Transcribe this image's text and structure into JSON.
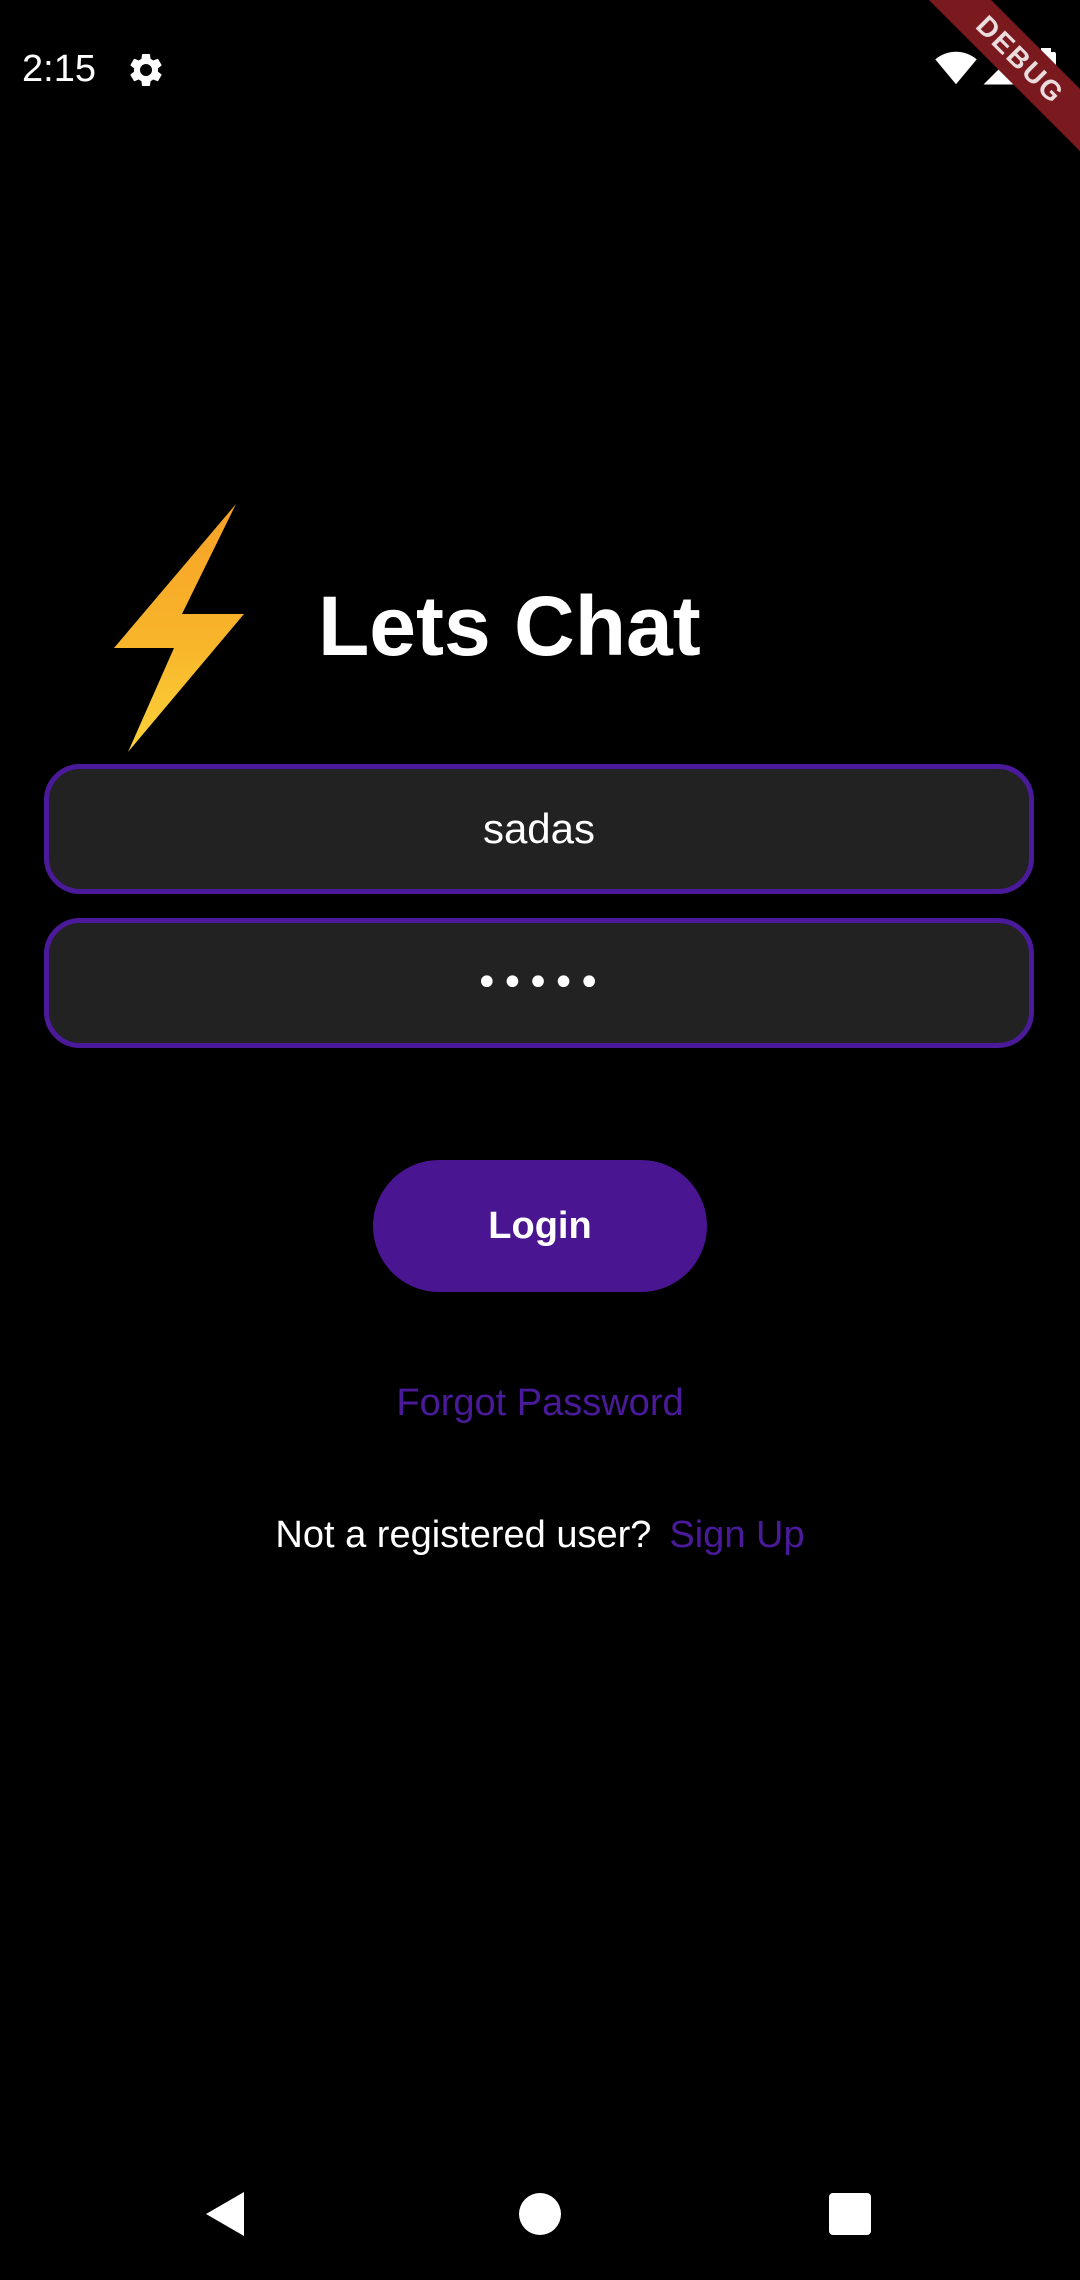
{
  "status_bar": {
    "time": "2:15",
    "icons": [
      "gear-icon",
      "wifi-icon",
      "signal-icon",
      "battery-icon"
    ]
  },
  "debug_banner": {
    "label": "DEBUG",
    "color": "#7a1a1f"
  },
  "header": {
    "logo_icon": "lightning-bolt-icon",
    "title": "Lets Chat"
  },
  "form": {
    "username": {
      "value": "sadas"
    },
    "password": {
      "masked_value": "•••••"
    },
    "login_label": "Login",
    "forgot_password_label": "Forgot Password",
    "signup_prompt": "Not a registered user?",
    "signup_label": "Sign Up"
  },
  "nav_bar": {
    "icons": [
      "back-icon",
      "home-icon",
      "recents-icon"
    ]
  },
  "colors": {
    "background": "#000000",
    "accent": "#4a1591",
    "field_fill": "#222222",
    "field_border": "#4a1a9a",
    "bolt_top": "#f7a128",
    "bolt_bottom": "#fbd23a"
  }
}
